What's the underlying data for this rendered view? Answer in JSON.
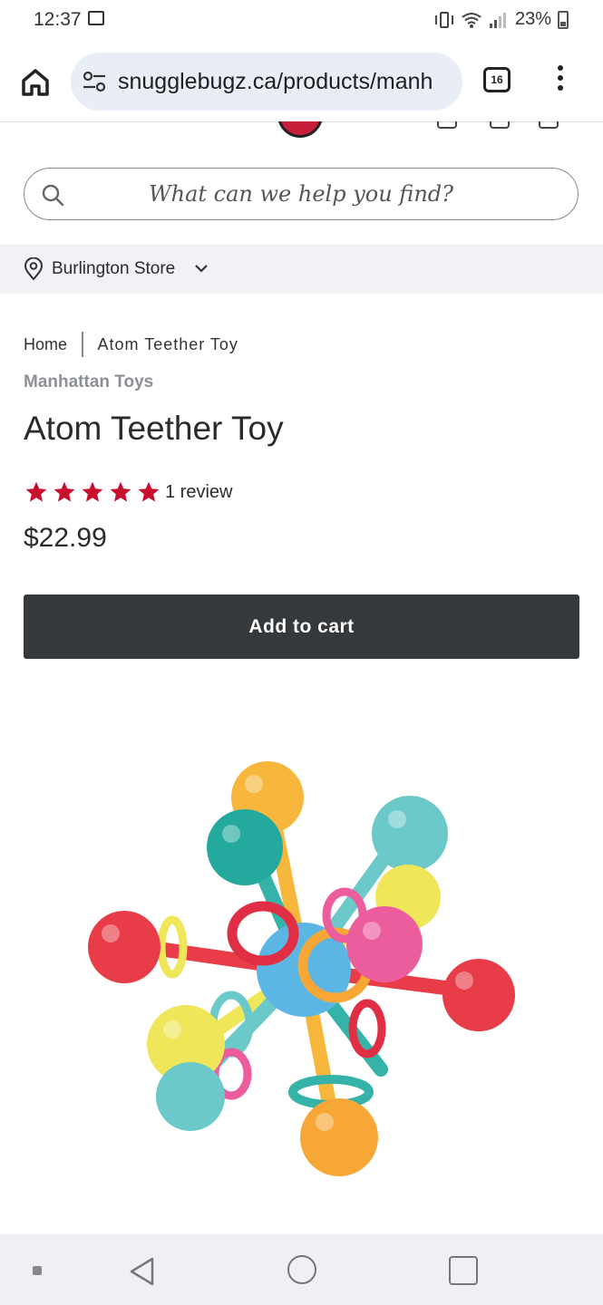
{
  "status_bar": {
    "time": "12:37",
    "battery": "23%"
  },
  "browser": {
    "url": "snugglebugz.ca/products/manh",
    "tab_count": "16"
  },
  "search": {
    "placeholder": "What can we help you find?"
  },
  "store": {
    "label": "Burlington Store"
  },
  "breadcrumb": {
    "home": "Home",
    "current": "Atom Teether Toy"
  },
  "product": {
    "brand": "Manhattan Toys",
    "title": "Atom Teether Toy",
    "rating": 5,
    "review_text": "1 review",
    "price": "$22.99",
    "add_to_cart": "Add to cart"
  },
  "colors": {
    "star": "#c8102e",
    "button": "#36393b",
    "store_bar": "#f0f2f5"
  }
}
